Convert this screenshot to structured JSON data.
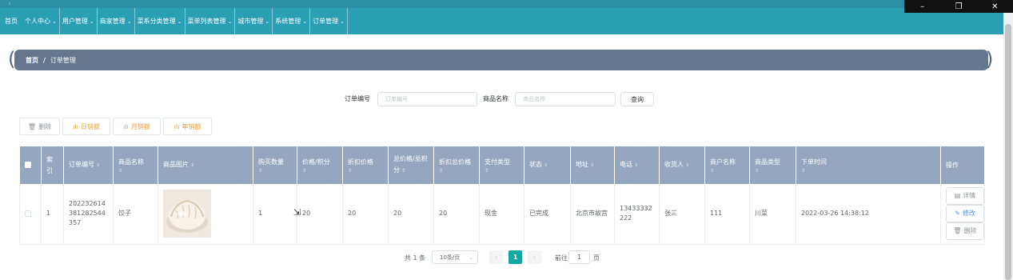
{
  "window": {
    "back_glyph": "‹",
    "minimize_glyph": "–",
    "restore_glyph": "❐",
    "close_glyph": "✕"
  },
  "nav": {
    "home": "首页",
    "menus": [
      "个人中心",
      "用户管理",
      "商家管理",
      "菜系分类管理",
      "菜单列表管理",
      "城市管理",
      "系统管理",
      "订单管理"
    ],
    "chevron": "⌄"
  },
  "breadcrumb": {
    "home": "首页",
    "separator": "/",
    "current": "订单管理"
  },
  "search": {
    "order_no_label": "订单编号",
    "order_no_placeholder": "订单编号",
    "product_label": "商品名称",
    "product_placeholder": "商品名称",
    "query_button": "查询"
  },
  "toolbar": {
    "delete": "删除",
    "daily_sales": "日销额",
    "monthly_sales": "月销额",
    "yearly_sales": "年销额"
  },
  "table": {
    "sort_glyph": "⇕",
    "headers": {
      "index": "索引",
      "order_no": "订单编号",
      "product_name": "商品名称",
      "product_image": "商品图片",
      "quantity": "购买数量",
      "price_points": "价格/积分",
      "discount_price": "折扣价格",
      "total_points": "总价格/总积分",
      "discount_total": "折扣总价格",
      "payment_type": "支付类型",
      "status": "状态",
      "address": "地址",
      "phone": "电话",
      "receiver": "收货人",
      "merchant": "商户名称",
      "category": "商品类型",
      "order_time": "下单时间",
      "actions": "操作"
    },
    "rows": [
      {
        "index": "1",
        "order_no": "202232614381282544357",
        "product_name": "饺子",
        "quantity": "1",
        "price_points": "20",
        "discount_price": "20",
        "total_points": "20",
        "discount_total": "20",
        "payment_type": "现金",
        "status": "已完成",
        "address": "北京市故宫",
        "phone": "13433332222",
        "receiver": "张三",
        "merchant": "111",
        "category": "川菜",
        "order_time": "2022-03-26 14:38:12"
      }
    ],
    "actions": {
      "detail": "详情",
      "edit": "修改",
      "delete": "删除"
    }
  },
  "pagination": {
    "total": "共 1 条",
    "page_size": "10条/页",
    "current_page": "1",
    "goto_label": "前往",
    "goto_value": "1",
    "page_suffix": "页"
  },
  "colors": {
    "nav_bg": "#2a9fb4",
    "breadcrumb_bg": "#65778f",
    "table_header_bg": "#95a7c0",
    "active_page": "#10a8a0",
    "stat_button_text": "#e6a23c"
  }
}
